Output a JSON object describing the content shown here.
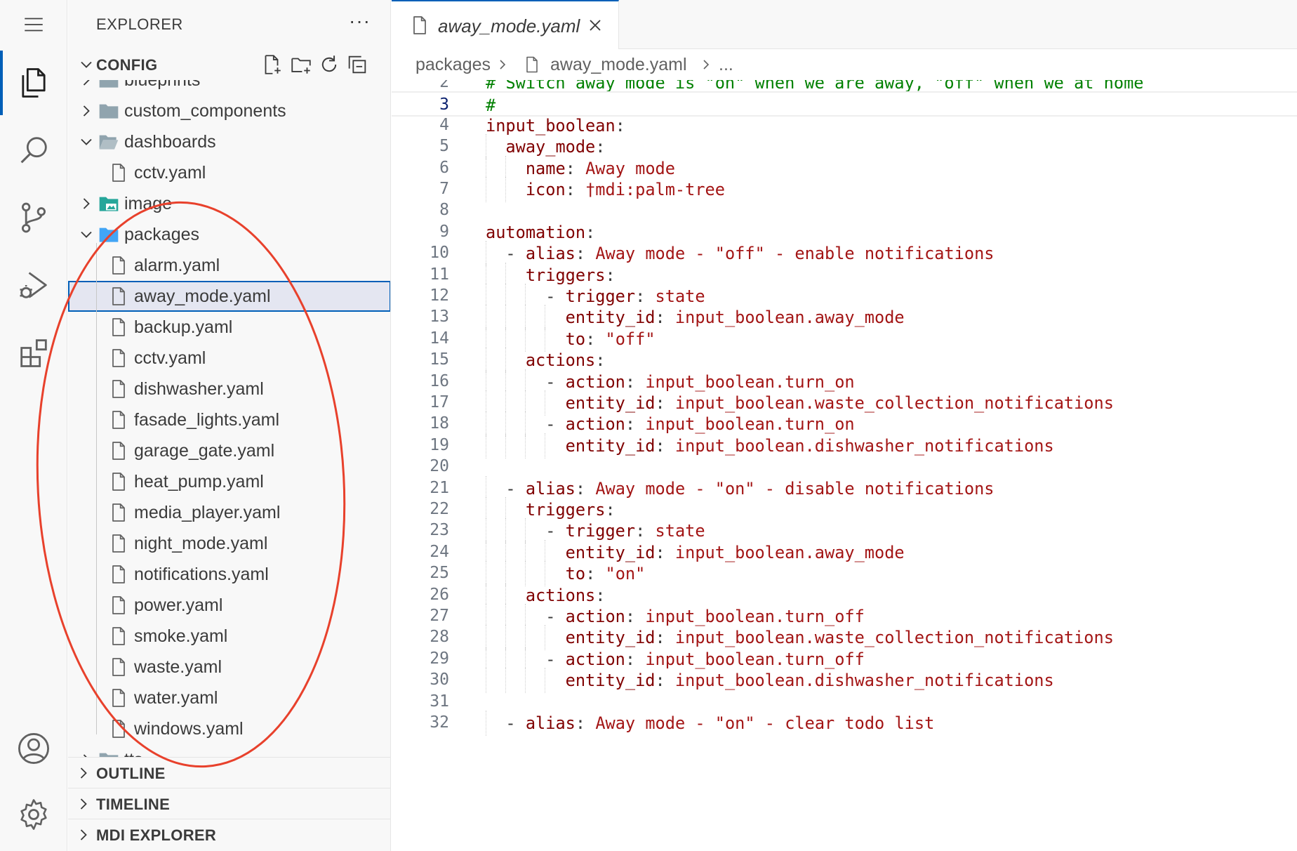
{
  "sidebar": {
    "title": "EXPLORER",
    "more": "···",
    "root": "CONFIG",
    "items": [
      {
        "label": "blueprints",
        "kind": "folder"
      },
      {
        "label": "custom_components",
        "kind": "folder"
      },
      {
        "label": "dashboards",
        "kind": "folder-open"
      },
      {
        "label": "cctv.yaml",
        "kind": "file"
      },
      {
        "label": "image",
        "kind": "folder-image"
      },
      {
        "label": "packages",
        "kind": "folder-open"
      },
      {
        "label": "alarm.yaml",
        "kind": "file"
      },
      {
        "label": "away_mode.yaml",
        "kind": "file"
      },
      {
        "label": "backup.yaml",
        "kind": "file"
      },
      {
        "label": "cctv.yaml",
        "kind": "file"
      },
      {
        "label": "dishwasher.yaml",
        "kind": "file"
      },
      {
        "label": "fasade_lights.yaml",
        "kind": "file"
      },
      {
        "label": "garage_gate.yaml",
        "kind": "file"
      },
      {
        "label": "heat_pump.yaml",
        "kind": "file"
      },
      {
        "label": "media_player.yaml",
        "kind": "file"
      },
      {
        "label": "night_mode.yaml",
        "kind": "file"
      },
      {
        "label": "notifications.yaml",
        "kind": "file"
      },
      {
        "label": "power.yaml",
        "kind": "file"
      },
      {
        "label": "smoke.yaml",
        "kind": "file"
      },
      {
        "label": "waste.yaml",
        "kind": "file"
      },
      {
        "label": "water.yaml",
        "kind": "file"
      },
      {
        "label": "windows.yaml",
        "kind": "file"
      },
      {
        "label": "tts",
        "kind": "folder"
      }
    ],
    "sections": [
      "OUTLINE",
      "TIMELINE",
      "MDI EXPLORER"
    ]
  },
  "editor": {
    "tab_label": "away_mode.yaml",
    "breadcrumb": [
      "packages",
      "away_mode.yaml",
      "..."
    ],
    "lines": [
      {
        "n": "2",
        "text": "# Switch away_mode is \"on\" when we are away, \"off\" when we at home"
      },
      {
        "n": "3",
        "text": "#"
      },
      {
        "n": "4",
        "text": "input_boolean:"
      },
      {
        "n": "5",
        "text": "  away_mode:"
      },
      {
        "n": "6",
        "text": "    name: Away mode"
      },
      {
        "n": "7",
        "text": "    icon: mdi:palm-tree"
      },
      {
        "n": "8",
        "text": ""
      },
      {
        "n": "9",
        "text": "automation:"
      },
      {
        "n": "10",
        "text": "  - alias: Away mode - \"off\" - enable notifications"
      },
      {
        "n": "11",
        "text": "    triggers:"
      },
      {
        "n": "12",
        "text": "      - trigger: state"
      },
      {
        "n": "13",
        "text": "        entity_id: input_boolean.away_mode"
      },
      {
        "n": "14",
        "text": "        to: \"off\""
      },
      {
        "n": "15",
        "text": "    actions:"
      },
      {
        "n": "16",
        "text": "      - action: input_boolean.turn_on"
      },
      {
        "n": "17",
        "text": "        entity_id: input_boolean.waste_collection_notifications"
      },
      {
        "n": "18",
        "text": "      - action: input_boolean.turn_on"
      },
      {
        "n": "19",
        "text": "        entity_id: input_boolean.dishwasher_notifications"
      },
      {
        "n": "20",
        "text": ""
      },
      {
        "n": "21",
        "text": "  - alias: Away mode - \"on\" - disable notifications"
      },
      {
        "n": "22",
        "text": "    triggers:"
      },
      {
        "n": "23",
        "text": "      - trigger: state"
      },
      {
        "n": "24",
        "text": "        entity_id: input_boolean.away_mode"
      },
      {
        "n": "25",
        "text": "        to: \"on\""
      },
      {
        "n": "26",
        "text": "    actions:"
      },
      {
        "n": "27",
        "text": "      - action: input_boolean.turn_off"
      },
      {
        "n": "28",
        "text": "        entity_id: input_boolean.waste_collection_notifications"
      },
      {
        "n": "29",
        "text": "      - action: input_boolean.turn_off"
      },
      {
        "n": "30",
        "text": "        entity_id: input_boolean.dishwasher_notifications"
      },
      {
        "n": "31",
        "text": ""
      },
      {
        "n": "32",
        "text": "  - alias: Away mode - \"on\" - clear todo list"
      }
    ]
  },
  "colors": {
    "accent": "#005fb8",
    "annotation": "#e8412c"
  },
  "icons": [
    "menu-icon",
    "files-icon",
    "search-icon",
    "source-control-icon",
    "run-debug-icon",
    "extensions-icon",
    "account-icon",
    "gear-icon"
  ]
}
